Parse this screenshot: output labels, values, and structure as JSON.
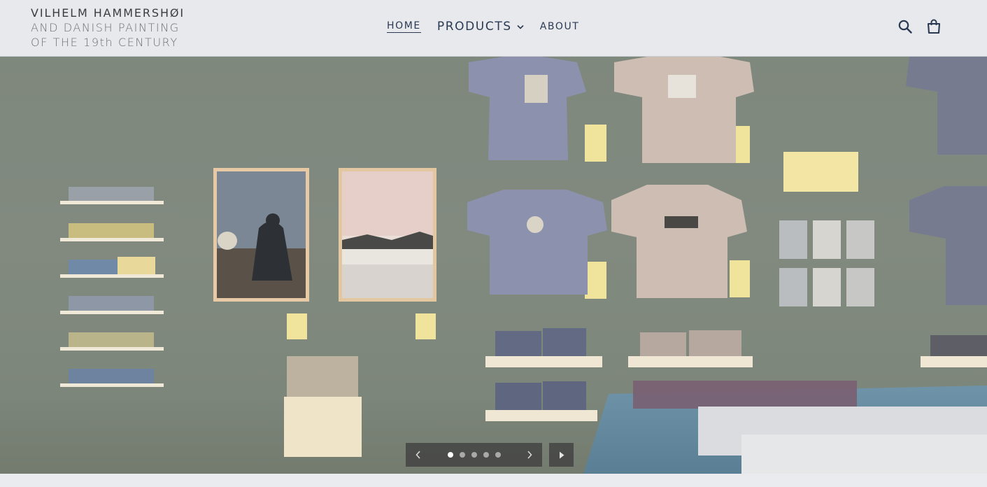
{
  "header": {
    "logo": {
      "line1": "VILHELM HAMMERSHØI",
      "line2": "AND DANISH PAINTING",
      "line3": "OF THE 19th CENTURY"
    },
    "nav": {
      "home": "HOME",
      "products": "PRODUCTS",
      "about": "ABOUT"
    },
    "icons": {
      "search": "search-icon",
      "cart": "cart-icon"
    }
  },
  "slideshow": {
    "slide_count": 5,
    "active_slide": 1,
    "prev_icon": "chevron-left-icon",
    "next_icon": "chevron-right-icon",
    "play_icon": "play-icon"
  },
  "colors": {
    "nav_text": "#2b3a52",
    "header_bg": "#e7e9ec",
    "wall": "#7f877d"
  }
}
